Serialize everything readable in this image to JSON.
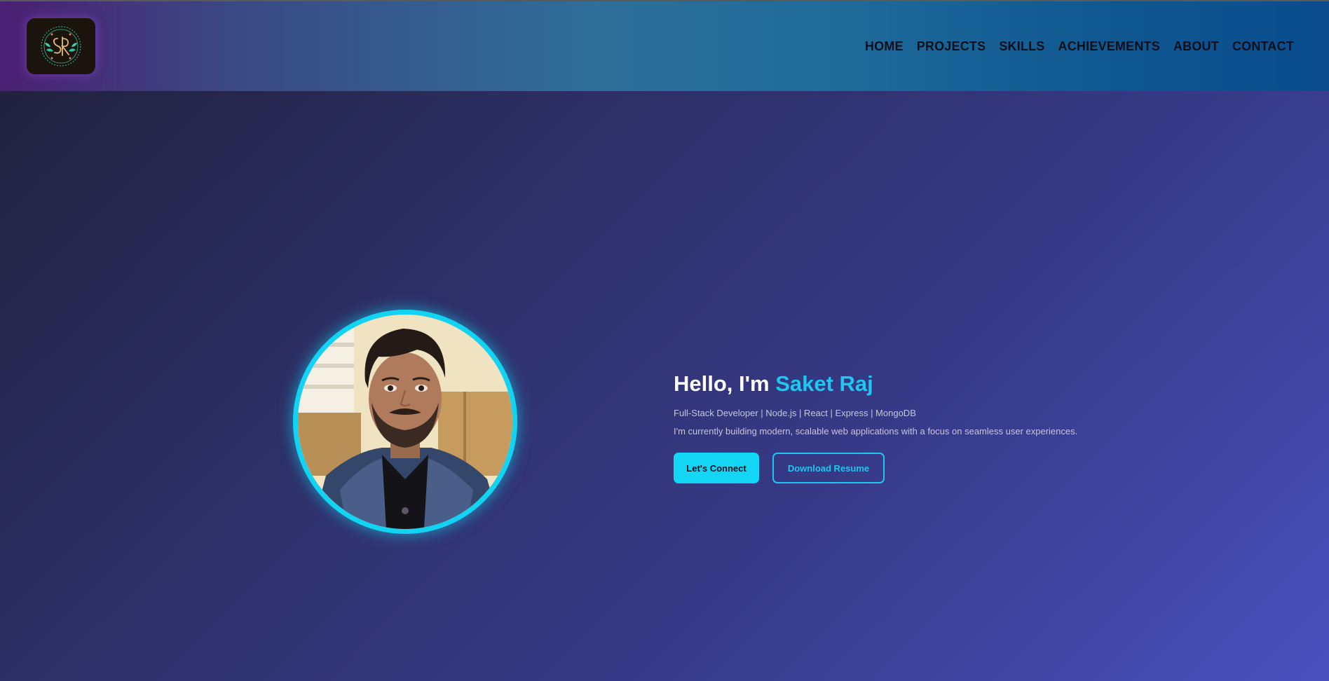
{
  "header": {
    "logo_icon": "sr-monogram-logo-icon",
    "nav": [
      {
        "label": "HOME"
      },
      {
        "label": "PROJECTS"
      },
      {
        "label": "SKILLS"
      },
      {
        "label": "ACHIEVEMENTS"
      },
      {
        "label": "ABOUT"
      },
      {
        "label": "CONTACT"
      }
    ]
  },
  "hero": {
    "greeting": "Hello, I'm",
    "name": "Saket Raj",
    "subtitle": "Full-Stack Developer | Node.js | React | Express | MongoDB",
    "description": "I'm currently building modern, scalable web applications with a focus on seamless user experiences.",
    "primary_button": "Let's Connect",
    "secondary_button": "Download Resume"
  },
  "colors": {
    "accent": "#1fc6ef",
    "button_fill": "#12d6f4",
    "nav_text": "#0d0f1a"
  }
}
